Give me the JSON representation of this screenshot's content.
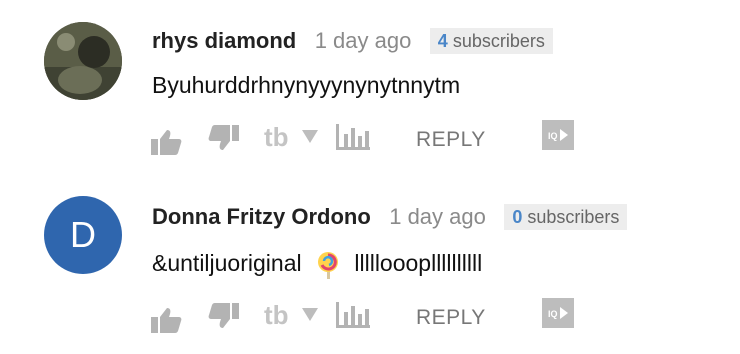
{
  "comments": [
    {
      "author": "rhys diamond",
      "time": "1 day ago",
      "subscriber_count": "4",
      "subscriber_label": "subscribers",
      "text": "Byuhurddrhnynyyynynytnnytm",
      "reply_label": "REPLY",
      "avatar_type": "photo"
    },
    {
      "author": "Donna Fritzy Ordono",
      "time": "1 day ago",
      "subscriber_count": "0",
      "subscriber_label": "subscribers",
      "text_before": "&untiljuoriginal",
      "text_after": "lllllooopllllllllll",
      "avatar_letter": "D",
      "reply_label": "REPLY",
      "avatar_type": "letter"
    }
  ],
  "icons": {
    "like": "thumbs-up-icon",
    "dislike": "thumbs-down-icon",
    "tubebuddy": "tubebuddy-icon",
    "dropdown": "caret-down-icon",
    "stats": "bar-chart-icon",
    "iq": "iq-icon",
    "emoji": "lollipop-icon"
  },
  "colors": {
    "avatar_letter_bg": "#2f66ae",
    "subscriber_count": "#4a86c8",
    "icon_gray": "#bdbdbd"
  }
}
